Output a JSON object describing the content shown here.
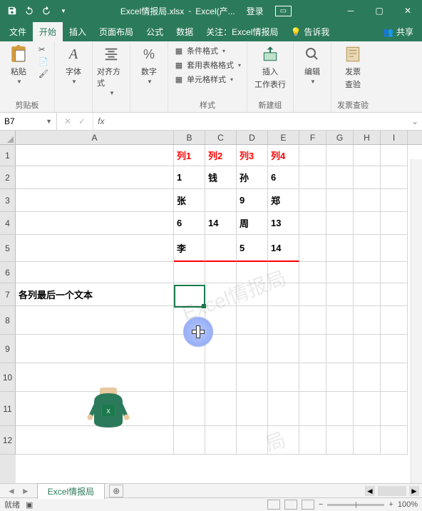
{
  "titlebar": {
    "filename": "Excel情报局.xlsx",
    "app": "Excel(产...",
    "login": "登录"
  },
  "tabs": {
    "file": "文件",
    "home": "开始",
    "insert": "插入",
    "layout": "页面布局",
    "formula": "公式",
    "data": "数据",
    "attention": "关注：Excel情报局",
    "tell": "告诉我",
    "share": "共享"
  },
  "ribbon": {
    "paste": "粘贴",
    "clipboard": "剪贴板",
    "font": "字体",
    "align": "对齐方式",
    "number": "数字",
    "cond_format": "条件格式",
    "table_format": "套用表格格式",
    "cell_format": "单元格样式",
    "style": "样式",
    "insert": "插入",
    "worksheet": "工作表行",
    "new_group": "新建组",
    "edit": "编辑",
    "invoice": "发票",
    "check": "查验",
    "invoice_check": "发票查验"
  },
  "formula_bar": {
    "name": "B7"
  },
  "grid": {
    "cols": [
      "A",
      "B",
      "C",
      "D",
      "E",
      "F",
      "G",
      "H",
      "I"
    ],
    "rows": [
      "1",
      "2",
      "3",
      "4",
      "5",
      "6",
      "7",
      "8",
      "9",
      "10",
      "11",
      "12"
    ],
    "headers": {
      "B": "列1",
      "C": "列2",
      "D": "列3",
      "E": "列4"
    },
    "data": {
      "r2": {
        "B": "1",
        "C": "钱",
        "D": "孙",
        "E": "6"
      },
      "r3": {
        "B": "张",
        "D": "9",
        "E": "郑"
      },
      "r4": {
        "B": "6",
        "C": "14",
        "D": "周",
        "E": "13"
      },
      "r5": {
        "B": "李",
        "D": "5",
        "E": "14"
      }
    },
    "A7": "各列最后一个文本",
    "watermark1": "Excel情报局",
    "watermark2": "局"
  },
  "sheet": {
    "name": "Excel情报局"
  },
  "status": {
    "ready": "就绪",
    "zoom": "100%"
  },
  "chart_data": {
    "type": "table",
    "title": "各列最后一个文本",
    "columns": [
      "列1",
      "列2",
      "列3",
      "列4"
    ],
    "rows": [
      [
        "1",
        "钱",
        "孙",
        "6"
      ],
      [
        "张",
        "",
        "9",
        "郑"
      ],
      [
        "6",
        "14",
        "周",
        "13"
      ],
      [
        "李",
        "",
        "5",
        "14"
      ]
    ]
  }
}
